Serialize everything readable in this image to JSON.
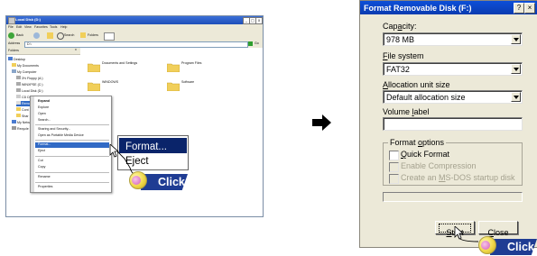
{
  "explorer": {
    "title": "Local Disk (D:)",
    "menu": [
      "File",
      "Edit",
      "View",
      "Favorites",
      "Tools",
      "Help"
    ],
    "toolbar": {
      "back": "Back",
      "search": "Search",
      "folders": "Folders"
    },
    "address_label": "Address",
    "address_value": "D:\\",
    "go_label": "Go",
    "folders_title": "Folders",
    "tree": [
      "Desktop",
      "My Documents",
      "My Computer",
      "3½ Floppy (A:)",
      "WINXPSE (C:)",
      "Local Disk (D:)",
      "CD Drive (E:)",
      "Removable Disk (F:)",
      "Cont",
      "Shar",
      "My Netw",
      "Recycle B"
    ],
    "content_items": [
      "Documents and Settings",
      "Program Files",
      "WINDOWS",
      "Software"
    ],
    "context_menu": [
      "Expand",
      "Explore",
      "Open",
      "Search...",
      "Sharing and Security...",
      "Open as Portable Media Device",
      "Format...",
      "Eject",
      "Cut",
      "Copy",
      "Rename",
      "Properties"
    ]
  },
  "zoom": {
    "format": "Format...",
    "eject": "Eject"
  },
  "click_label": "Click",
  "dialog": {
    "title": "Format Removable Disk (F:)",
    "help_btn": "?",
    "close_btn": "×",
    "capacity_label_pre": "Cap",
    "capacity_label_acc": "a",
    "capacity_label_post": "city:",
    "capacity_value": "978 MB",
    "filesystem_label_acc": "F",
    "filesystem_label_post": "ile system",
    "filesystem_value": "FAT32",
    "alloc_label_acc": "A",
    "alloc_label_post": "llocation unit size",
    "alloc_value": "Default allocation size",
    "volume_label_pre": "Volume ",
    "volume_label_acc": "l",
    "volume_label_post": "abel",
    "volume_value": "",
    "format_options_pre": "Format ",
    "format_options_acc": "o",
    "format_options_post": "ptions",
    "quick_acc": "Q",
    "quick_post": "uick Format",
    "compression_pre": "",
    "compression_label": "Enable Compression",
    "msdos_pre": "Create an ",
    "msdos_acc": "M",
    "msdos_post": "S-DOS startup disk",
    "start_acc": "S",
    "start_post": "tart",
    "close_acc": "C",
    "close_post": "lose"
  },
  "colors": {
    "brand_blue": "#1f3c93",
    "selection": "#0a246a"
  }
}
